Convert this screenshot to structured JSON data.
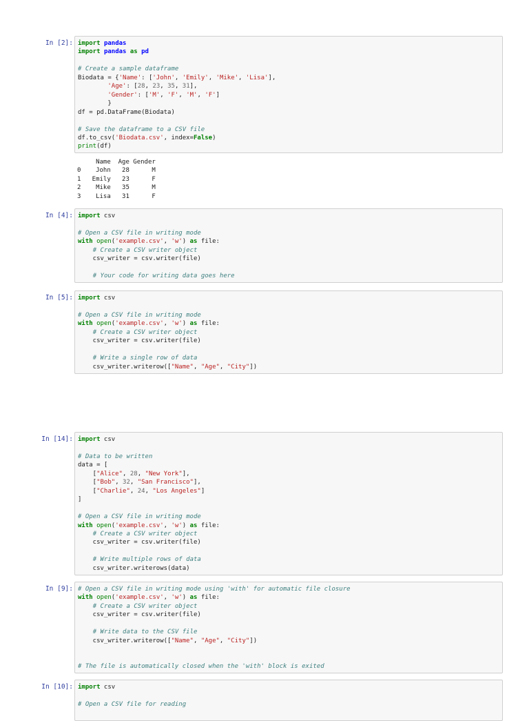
{
  "cells": [
    {
      "prompt": "In [2]:",
      "lines": [
        [
          [
            "k",
            "import"
          ],
          [
            "t",
            " "
          ],
          [
            "n",
            "pandas"
          ]
        ],
        [
          [
            "k",
            "import"
          ],
          [
            "t",
            " "
          ],
          [
            "n",
            "pandas"
          ],
          [
            "t",
            " "
          ],
          [
            "k",
            "as"
          ],
          [
            "t",
            " "
          ],
          [
            "n",
            "pd"
          ]
        ],
        [],
        [
          [
            "c",
            "# Create a sample dataframe"
          ]
        ],
        [
          [
            "t",
            "Biodata = {"
          ],
          [
            "s",
            "'Name'"
          ],
          [
            "t",
            ": ["
          ],
          [
            "s",
            "'John'"
          ],
          [
            "t",
            ", "
          ],
          [
            "s",
            "'Emily'"
          ],
          [
            "t",
            ", "
          ],
          [
            "s",
            "'Mike'"
          ],
          [
            "t",
            ", "
          ],
          [
            "s",
            "'Lisa'"
          ],
          [
            "t",
            "],"
          ]
        ],
        [
          [
            "t",
            "        "
          ],
          [
            "s",
            "'Age'"
          ],
          [
            "t",
            ": ["
          ],
          [
            "m",
            "28"
          ],
          [
            "t",
            ", "
          ],
          [
            "m",
            "23"
          ],
          [
            "t",
            ", "
          ],
          [
            "m",
            "35"
          ],
          [
            "t",
            ", "
          ],
          [
            "m",
            "31"
          ],
          [
            "t",
            "],"
          ]
        ],
        [
          [
            "t",
            "        "
          ],
          [
            "s",
            "'Gender'"
          ],
          [
            "t",
            ": ["
          ],
          [
            "s",
            "'M'"
          ],
          [
            "t",
            ", "
          ],
          [
            "s",
            "'F'"
          ],
          [
            "t",
            ", "
          ],
          [
            "s",
            "'M'"
          ],
          [
            "t",
            ", "
          ],
          [
            "s",
            "'F'"
          ],
          [
            "t",
            "]"
          ]
        ],
        [
          [
            "t",
            "        }"
          ]
        ],
        [
          [
            "t",
            "df = pd.DataFrame(Biodata)"
          ]
        ],
        [],
        [
          [
            "c",
            "# Save the dataframe to a CSV file"
          ]
        ],
        [
          [
            "t",
            "df.to_csv("
          ],
          [
            "s",
            "'Biodata.csv'"
          ],
          [
            "t",
            ", index="
          ],
          [
            "k",
            "False"
          ],
          [
            "t",
            ")"
          ]
        ],
        [
          [
            "b",
            "print"
          ],
          [
            "t",
            "(df)"
          ]
        ]
      ],
      "output": "     Name  Age Gender\n0    John   28      M\n1   Emily   23      F\n2    Mike   35      M\n3    Lisa   31      F"
    },
    {
      "prompt": "In [4]:",
      "lines": [
        [
          [
            "k",
            "import"
          ],
          [
            "t",
            " csv"
          ]
        ],
        [],
        [
          [
            "c",
            "# Open a CSV file in writing mode"
          ]
        ],
        [
          [
            "k",
            "with"
          ],
          [
            "t",
            " "
          ],
          [
            "b",
            "open"
          ],
          [
            "t",
            "("
          ],
          [
            "s",
            "'example.csv'"
          ],
          [
            "t",
            ", "
          ],
          [
            "s",
            "'w'"
          ],
          [
            "t",
            ") "
          ],
          [
            "k",
            "as"
          ],
          [
            "t",
            " file:"
          ]
        ],
        [
          [
            "t",
            "    "
          ],
          [
            "c",
            "# Create a CSV writer object"
          ]
        ],
        [
          [
            "t",
            "    csv_writer = csv.writer(file)"
          ]
        ],
        [],
        [
          [
            "t",
            "    "
          ],
          [
            "c",
            "# Your code for writing data goes here"
          ]
        ]
      ]
    },
    {
      "prompt": "In [5]:",
      "lines": [
        [
          [
            "k",
            "import"
          ],
          [
            "t",
            " csv"
          ]
        ],
        [],
        [
          [
            "c",
            "# Open a CSV file in writing mode"
          ]
        ],
        [
          [
            "k",
            "with"
          ],
          [
            "t",
            " "
          ],
          [
            "b",
            "open"
          ],
          [
            "t",
            "("
          ],
          [
            "s",
            "'example.csv'"
          ],
          [
            "t",
            ", "
          ],
          [
            "s",
            "'w'"
          ],
          [
            "t",
            ") "
          ],
          [
            "k",
            "as"
          ],
          [
            "t",
            " file:"
          ]
        ],
        [
          [
            "t",
            "    "
          ],
          [
            "c",
            "# Create a CSV writer object"
          ]
        ],
        [
          [
            "t",
            "    csv_writer = csv.writer(file)"
          ]
        ],
        [],
        [
          [
            "t",
            "    "
          ],
          [
            "c",
            "# Write a single row of data"
          ]
        ],
        [
          [
            "t",
            "    csv_writer.writerow(["
          ],
          [
            "s",
            "\"Name\""
          ],
          [
            "t",
            ", "
          ],
          [
            "s",
            "\"Age\""
          ],
          [
            "t",
            ", "
          ],
          [
            "s",
            "\"City\""
          ],
          [
            "t",
            "])"
          ]
        ]
      ]
    },
    {
      "prompt": "In [14]:",
      "lines": [
        [
          [
            "k",
            "import"
          ],
          [
            "t",
            " csv"
          ]
        ],
        [],
        [
          [
            "c",
            "# Data to be written"
          ]
        ],
        [
          [
            "t",
            "data = ["
          ]
        ],
        [
          [
            "t",
            "    ["
          ],
          [
            "s",
            "\"Alice\""
          ],
          [
            "t",
            ", "
          ],
          [
            "m",
            "28"
          ],
          [
            "t",
            ", "
          ],
          [
            "s",
            "\"New York\""
          ],
          [
            "t",
            "],"
          ]
        ],
        [
          [
            "t",
            "    ["
          ],
          [
            "s",
            "\"Bob\""
          ],
          [
            "t",
            ", "
          ],
          [
            "m",
            "32"
          ],
          [
            "t",
            ", "
          ],
          [
            "s",
            "\"San Francisco\""
          ],
          [
            "t",
            "],"
          ]
        ],
        [
          [
            "t",
            "    ["
          ],
          [
            "s",
            "\"Charlie\""
          ],
          [
            "t",
            ", "
          ],
          [
            "m",
            "24"
          ],
          [
            "t",
            ", "
          ],
          [
            "s",
            "\"Los Angeles\""
          ],
          [
            "t",
            "]"
          ]
        ],
        [
          [
            "t",
            "]"
          ]
        ],
        [],
        [
          [
            "c",
            "# Open a CSV file in writing mode"
          ]
        ],
        [
          [
            "k",
            "with"
          ],
          [
            "t",
            " "
          ],
          [
            "b",
            "open"
          ],
          [
            "t",
            "("
          ],
          [
            "s",
            "'example.csv'"
          ],
          [
            "t",
            ", "
          ],
          [
            "s",
            "'w'"
          ],
          [
            "t",
            ") "
          ],
          [
            "k",
            "as"
          ],
          [
            "t",
            " file:"
          ]
        ],
        [
          [
            "t",
            "    "
          ],
          [
            "c",
            "# Create a CSV writer object"
          ]
        ],
        [
          [
            "t",
            "    csv_writer = csv.writer(file)"
          ]
        ],
        [],
        [
          [
            "t",
            "    "
          ],
          [
            "c",
            "# Write multiple rows of data"
          ]
        ],
        [
          [
            "t",
            "    csv_writer.writerows(data)"
          ]
        ]
      ]
    },
    {
      "prompt": "In [9]:",
      "lines": [
        [
          [
            "c",
            "# Open a CSV file in writing mode using 'with' for automatic file closure"
          ]
        ],
        [
          [
            "k",
            "with"
          ],
          [
            "t",
            " "
          ],
          [
            "b",
            "open"
          ],
          [
            "t",
            "("
          ],
          [
            "s",
            "'example.csv'"
          ],
          [
            "t",
            ", "
          ],
          [
            "s",
            "'w'"
          ],
          [
            "t",
            ") "
          ],
          [
            "k",
            "as"
          ],
          [
            "t",
            " file:"
          ]
        ],
        [
          [
            "t",
            "    "
          ],
          [
            "c",
            "# Create a CSV writer object"
          ]
        ],
        [
          [
            "t",
            "    csv_writer = csv.writer(file)"
          ]
        ],
        [],
        [
          [
            "t",
            "    "
          ],
          [
            "c",
            "# Write data to the CSV file"
          ]
        ],
        [
          [
            "t",
            "    csv_writer.writerow(["
          ],
          [
            "s",
            "\"Name\""
          ],
          [
            "t",
            ", "
          ],
          [
            "s",
            "\"Age\""
          ],
          [
            "t",
            ", "
          ],
          [
            "s",
            "\"City\""
          ],
          [
            "t",
            "])"
          ]
        ],
        [],
        [],
        [
          [
            "c",
            "# The file is automatically closed when the 'with' block is exited"
          ]
        ]
      ]
    },
    {
      "prompt": "In [10]:",
      "lines": [
        [
          [
            "k",
            "import"
          ],
          [
            "t",
            " csv"
          ]
        ],
        [],
        [
          [
            "c",
            "# Open a CSV file for reading"
          ]
        ]
      ]
    }
  ]
}
